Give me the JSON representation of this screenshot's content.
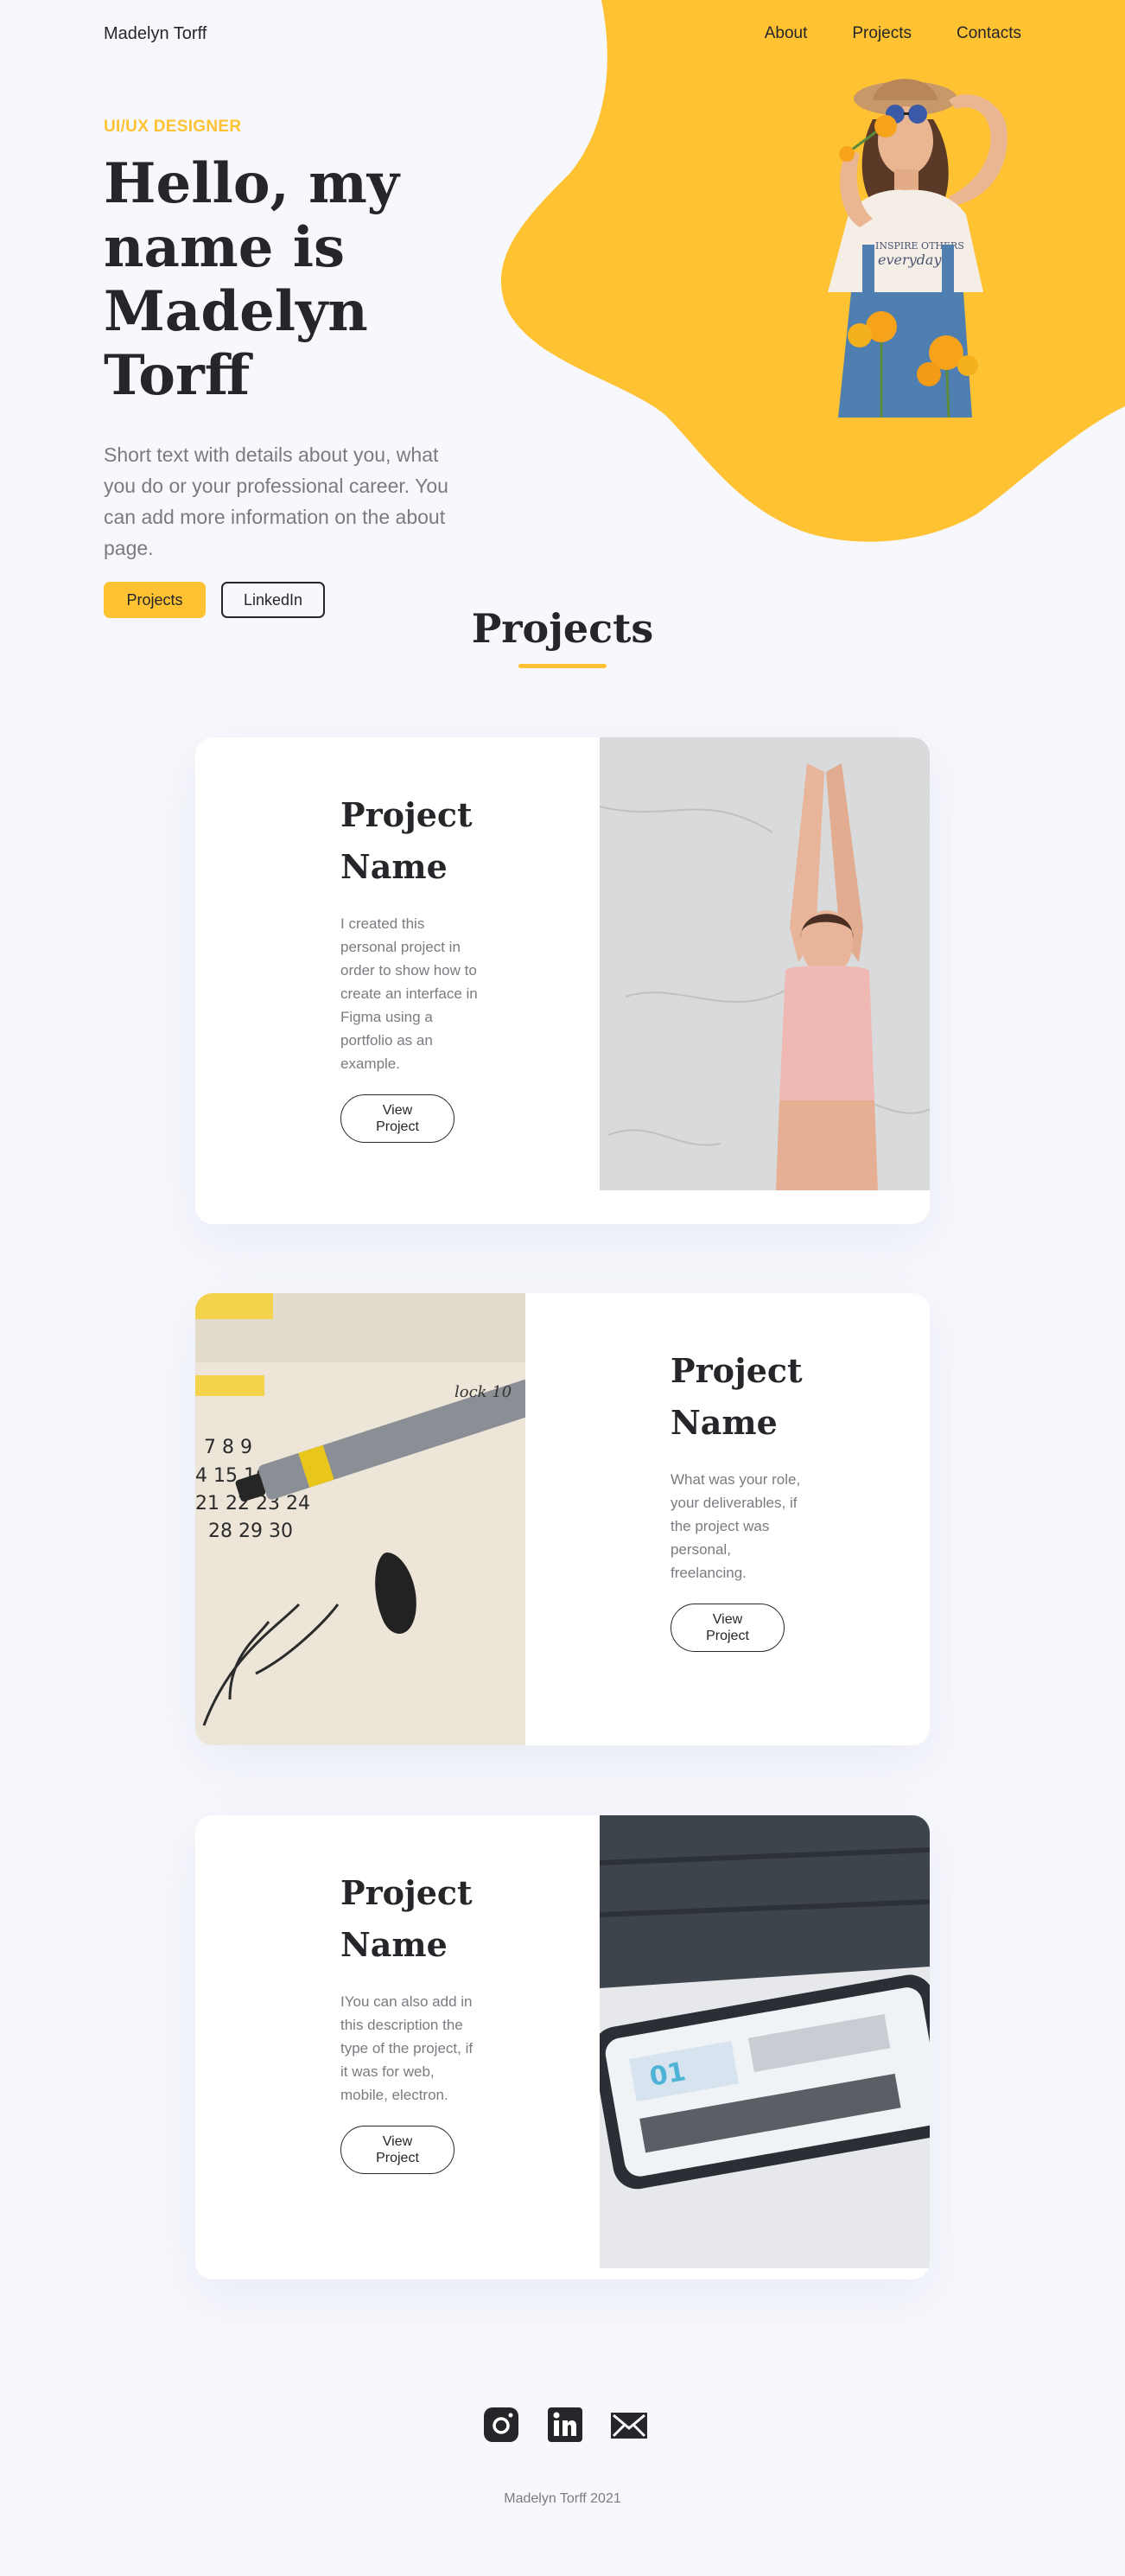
{
  "colors": {
    "accent": "#FFC232",
    "text": "#25262A",
    "muted": "#7A7B80",
    "background": "#F7F8FD"
  },
  "nav": {
    "brand": "Madelyn Torff",
    "links": [
      "About",
      "Projects",
      "Contacts"
    ]
  },
  "hero": {
    "eyebrow": "UI/UX DESIGNER",
    "title": "Hello, my name is Madelyn Torff",
    "text": "Short text with details about you, what you do or your professional career. You can add more information on the about page.",
    "primary_button": "Projects",
    "secondary_button": "LinkedIn"
  },
  "projects": {
    "title": "Projects",
    "items": [
      {
        "title": "Project Name",
        "description": "I created this personal project in order to show how to create an interface in Figma using a portfolio as an example.",
        "button": "View Project"
      },
      {
        "title": "Project Name",
        "description": "What was your role, your deliverables, if the project was personal, freelancing.",
        "button": "View Project"
      },
      {
        "title": "Project Name",
        "description": "IYou can also add in this description the type of the project, if it was for web, mobile, electron.",
        "button": "View Project"
      }
    ]
  },
  "footer": {
    "icons": [
      "instagram-icon",
      "linkedin-icon",
      "mail-icon"
    ],
    "copyright": "Madelyn Torff 2021"
  }
}
